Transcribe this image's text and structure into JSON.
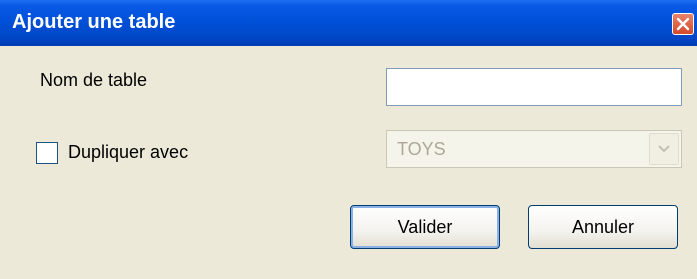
{
  "window": {
    "title": "Ajouter une table"
  },
  "form": {
    "table_name_label": "Nom de table",
    "table_name_value": "",
    "duplicate_label": "Dupliquer avec",
    "duplicate_checked": false,
    "duplicate_select_value": "TOYS"
  },
  "buttons": {
    "validate_label": "Valider",
    "cancel_label": "Annuler"
  },
  "colors": {
    "titlebar": "#0050d8",
    "close_button": "#d2492a",
    "dialog_background": "#ece9d8",
    "button_border": "#003c74"
  }
}
